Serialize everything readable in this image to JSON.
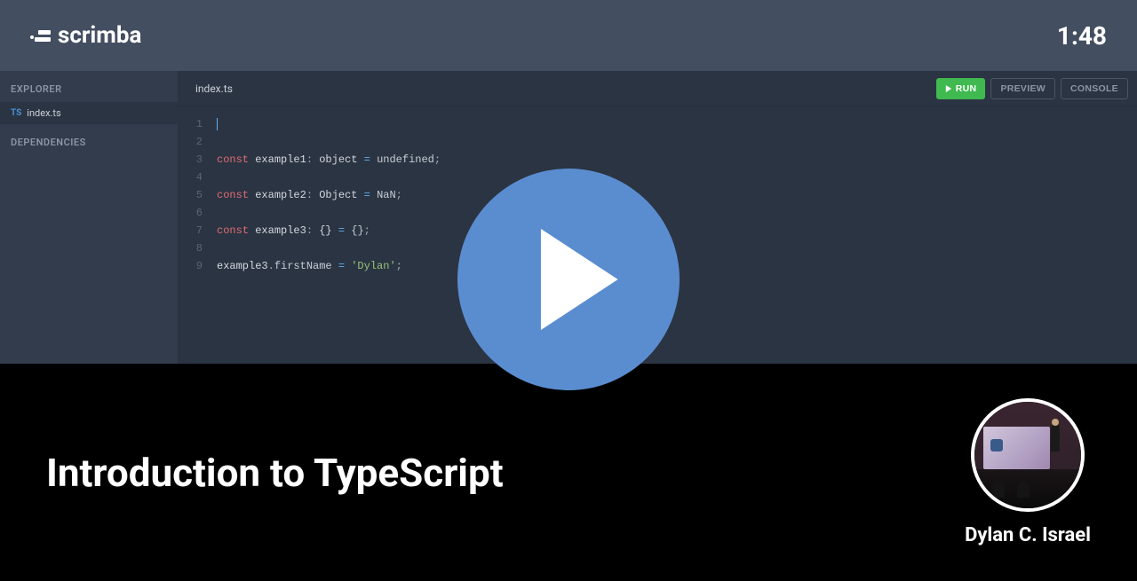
{
  "header": {
    "brand": "scrimba",
    "time": "1:48"
  },
  "sidebar": {
    "explorer_label": "EXPLORER",
    "dependencies_label": "DEPENDENCIES",
    "file": {
      "badge": "TS",
      "name": "index.ts"
    }
  },
  "editor": {
    "tab_name": "index.ts",
    "actions": {
      "run": "RUN",
      "preview": "PREVIEW",
      "console": "CONSOLE"
    },
    "code_lines": [
      {
        "num": "1",
        "tokens": []
      },
      {
        "num": "2",
        "tokens": []
      },
      {
        "num": "3",
        "tokens": [
          {
            "t": "keyword",
            "v": "const"
          },
          {
            "t": "plain",
            "v": " "
          },
          {
            "t": "ident",
            "v": "example1"
          },
          {
            "t": "punct",
            "v": ": "
          },
          {
            "t": "type",
            "v": "object"
          },
          {
            "t": "plain",
            "v": " "
          },
          {
            "t": "op",
            "v": "="
          },
          {
            "t": "plain",
            "v": " "
          },
          {
            "t": "value",
            "v": "undefined"
          },
          {
            "t": "punct",
            "v": ";"
          }
        ]
      },
      {
        "num": "4",
        "tokens": []
      },
      {
        "num": "5",
        "tokens": [
          {
            "t": "keyword",
            "v": "const"
          },
          {
            "t": "plain",
            "v": " "
          },
          {
            "t": "ident",
            "v": "example2"
          },
          {
            "t": "punct",
            "v": ": "
          },
          {
            "t": "type",
            "v": "Object"
          },
          {
            "t": "plain",
            "v": " "
          },
          {
            "t": "op",
            "v": "="
          },
          {
            "t": "plain",
            "v": " "
          },
          {
            "t": "value",
            "v": "NaN"
          },
          {
            "t": "punct",
            "v": ";"
          }
        ]
      },
      {
        "num": "6",
        "tokens": []
      },
      {
        "num": "7",
        "tokens": [
          {
            "t": "keyword",
            "v": "const"
          },
          {
            "t": "plain",
            "v": " "
          },
          {
            "t": "ident",
            "v": "example3"
          },
          {
            "t": "punct",
            "v": ": "
          },
          {
            "t": "type",
            "v": "{}"
          },
          {
            "t": "plain",
            "v": " "
          },
          {
            "t": "op",
            "v": "="
          },
          {
            "t": "plain",
            "v": " "
          },
          {
            "t": "value",
            "v": "{}"
          },
          {
            "t": "punct",
            "v": ";"
          }
        ]
      },
      {
        "num": "8",
        "tokens": []
      },
      {
        "num": "9",
        "tokens": [
          {
            "t": "ident",
            "v": "example3"
          },
          {
            "t": "punct",
            "v": "."
          },
          {
            "t": "prop",
            "v": "firstName"
          },
          {
            "t": "plain",
            "v": " "
          },
          {
            "t": "op",
            "v": "="
          },
          {
            "t": "plain",
            "v": " "
          },
          {
            "t": "string",
            "v": "'Dylan'"
          },
          {
            "t": "punct",
            "v": ";"
          }
        ]
      }
    ]
  },
  "footer": {
    "course_title": "Introduction to TypeScript",
    "instructor_name": "Dylan C. Israel"
  }
}
